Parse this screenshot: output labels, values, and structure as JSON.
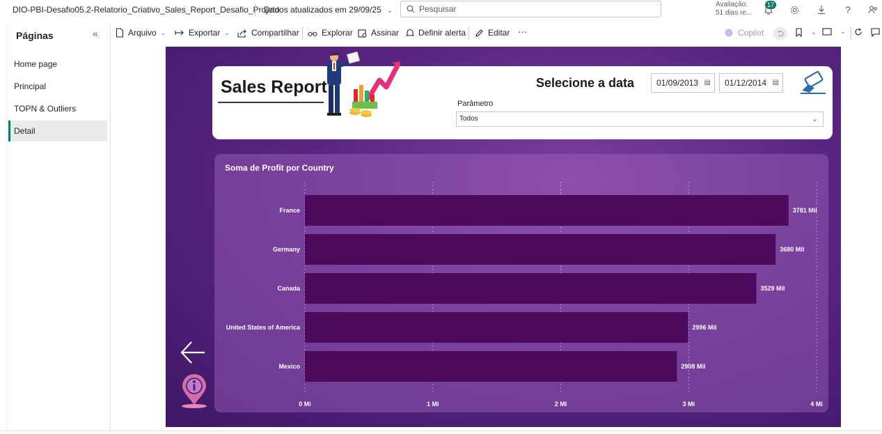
{
  "topbar": {
    "file_title": "DIO-PBI-Desafio05.2-Relatorio_Criativo_Sales_Report_Desafio_Projeto",
    "updated": "Dados atualizados em 29/09/25",
    "search_placeholder": "Pesquisar",
    "eval_line1": "Avaliação:",
    "eval_line2": "51 dias re...",
    "notif_count": "17"
  },
  "sidebar": {
    "title": "Páginas",
    "items": [
      {
        "label": "Home page"
      },
      {
        "label": "Principal"
      },
      {
        "label": "TOPN & Outliers"
      },
      {
        "label": "Detail"
      }
    ]
  },
  "toolbar": {
    "arquivo": "Arquivo",
    "exportar": "Exportar",
    "compartilhar": "Compartilhar",
    "explorar": "Explorar",
    "assinar": "Assinar",
    "definir_alerta": "Definir alerta",
    "editar": "Editar",
    "more": "···",
    "copilot": "Copilot"
  },
  "report": {
    "title": "Sales Report",
    "date_label": "Selecione a data",
    "date_start": "01/09/2013",
    "date_end": "01/12/2014",
    "param_label": "Parâmetro",
    "param_value": "Todos"
  },
  "chart_data": {
    "type": "bar",
    "orientation": "horizontal",
    "title": "Soma de Profit por Country",
    "categories": [
      "France",
      "Germany",
      "Canada",
      "United States of America",
      "Mexico"
    ],
    "values": [
      3781,
      3680,
      3529,
      2996,
      2908
    ],
    "data_labels": [
      "3781 Mil",
      "3680 Mil",
      "3529 Mil",
      "2996 Mil",
      "2908 Mil"
    ],
    "xticks": [
      "0 Mi",
      "1 Mi",
      "2 Mi",
      "3 Mi",
      "4 Mi"
    ],
    "xlim": [
      0,
      4000
    ],
    "grid": true,
    "colors": {
      "bar": "#4d0a5c",
      "text": "#ffffff"
    }
  }
}
